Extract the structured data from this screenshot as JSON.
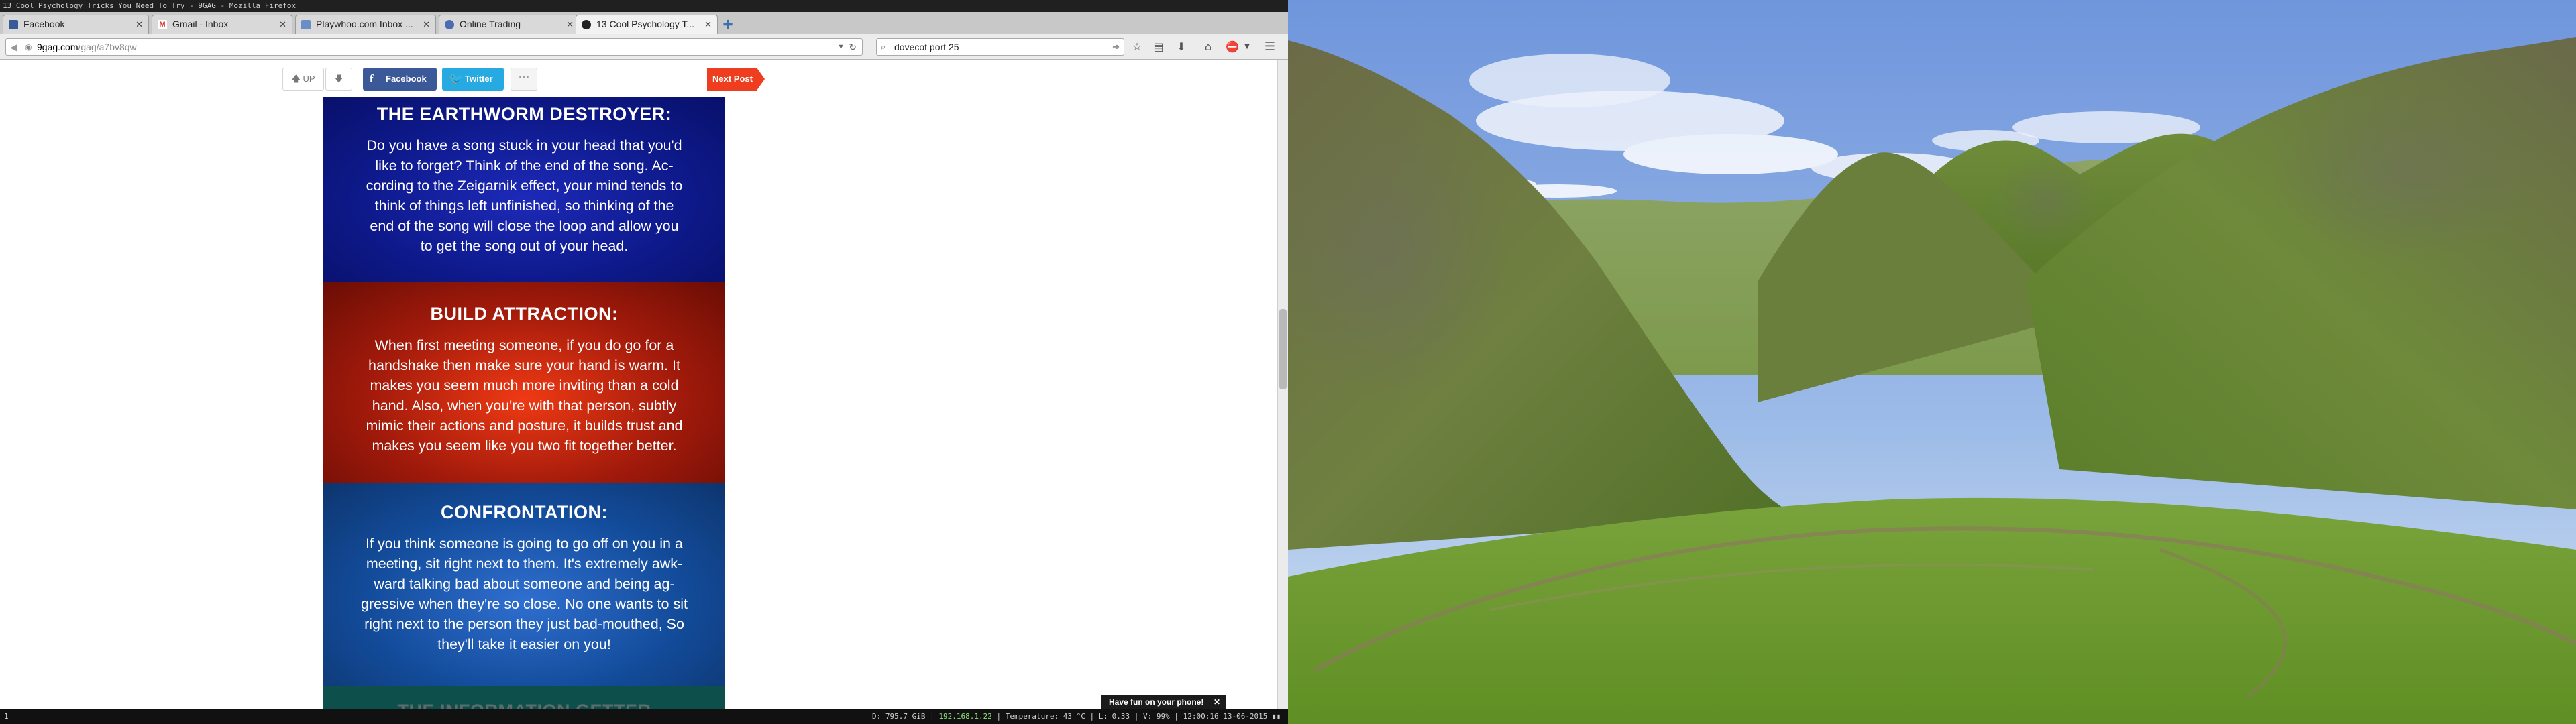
{
  "window": {
    "title": "13 Cool Psychology Tricks You Need To Try - 9GAG - Mozilla Firefox"
  },
  "tabs": [
    {
      "label": "Facebook",
      "favicon_color": "#3b5998"
    },
    {
      "label": "Gmail - Inbox",
      "favicon_color": "#d93025"
    },
    {
      "label": "Playwhoo.com Inbox ...",
      "favicon_color": "#6a8fc7"
    },
    {
      "label": "Online Trading",
      "favicon_color": "#4a6cb0"
    },
    {
      "label": "13 Cool Psychology T...",
      "favicon_color": "#222222",
      "active": true
    }
  ],
  "toolbar": {
    "url_domain": "9gag.com",
    "url_path": "/gag/a7bv8qw",
    "search_text": "dovecot port 25"
  },
  "post_actions": {
    "upvote_label": "UP",
    "facebook_label": "Facebook",
    "twitter_label": "Twitter",
    "more_label": "···",
    "next_post_label": "Next Post"
  },
  "article": {
    "sections": [
      {
        "heading": "THE EARTHWORM DESTROYER:",
        "lines": [
          "Do you have a song stuck in your head that you'd",
          "like to forget? Think of the end of the song. Ac-",
          "cording to the Zeigarnik effect, your mind tends to",
          "think of things left unfinished, so thinking of the",
          "end of the song will close the loop and allow you",
          "to get the song out of your head."
        ]
      },
      {
        "heading": "BUILD ATTRACTION:",
        "lines": [
          "When first meeting someone, if you do go for a",
          "handshake then make sure your hand is warm. It",
          "makes you seem much more inviting than a cold",
          "hand. Also, when you're with that person, subtly",
          "mimic their actions and posture, it builds trust and",
          "makes you seem like you two fit together better."
        ]
      },
      {
        "heading": "CONFRONTATION:",
        "lines": [
          "If you think someone is going to go off on you in a",
          "meeting, sit right next to them. It's extremely awk-",
          "ward talking bad about someone and being ag-",
          "gressive when they're so close. No one wants to sit",
          "right next to the person they just bad-mouthed, So",
          "they'll take it easier on you!"
        ]
      },
      {
        "heading": "THE INFORMATION GETTER"
      }
    ]
  },
  "toast": {
    "text": "Have fun on your phone!",
    "close": "✕"
  },
  "statusbar": {
    "workspace": "1",
    "disk": "D: 795.7 GiB |",
    "ip": "192.168.1.22",
    "rest": "| Temperature: 43 °C | L: 0.33 | V: 99% | 12:00:16 13-06-2015"
  }
}
